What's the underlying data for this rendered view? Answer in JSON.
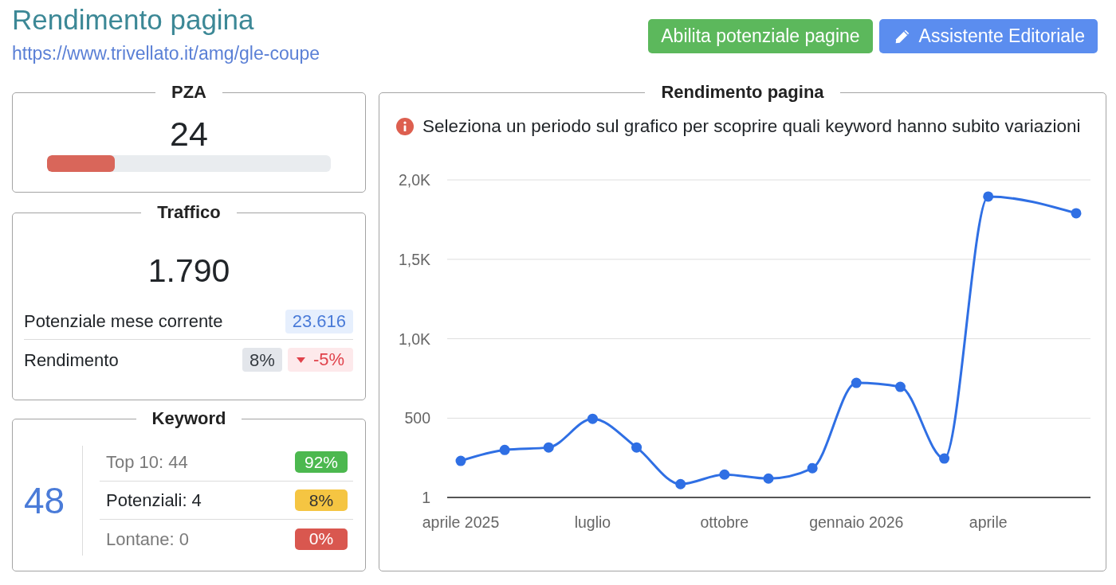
{
  "header": {
    "title": "Rendimento pagina",
    "url": "https://www.trivellato.it/amg/gle-coupe",
    "buttons": [
      {
        "label": "Abilita potenziale pagine",
        "kind": "plain",
        "color": "#5cb85c"
      },
      {
        "label": "Assistente Editoriale",
        "kind": "icon",
        "color": "#5b8def"
      }
    ]
  },
  "pza": {
    "title": "PZA",
    "value": "24",
    "level": 0.24
  },
  "traffic": {
    "title": "Traffico",
    "value": "1.790",
    "rows": [
      {
        "label": "Potenziale mese corrente",
        "badges": [
          {
            "text": "23.616",
            "kind": "info"
          }
        ]
      },
      {
        "label": "Rendimento",
        "badges": [
          {
            "text": "8%",
            "kind": "neutral"
          },
          {
            "text": "-5%",
            "kind": "down"
          }
        ]
      }
    ]
  },
  "keywords": {
    "title": "Keyword",
    "total": "48",
    "rows": [
      {
        "label": "Top 10: 44",
        "share": "92%",
        "color": "#4cb84f",
        "emphasized": false
      },
      {
        "label": "Potenziali: 4",
        "share": "8%",
        "color": "#f5c542",
        "emphasized": true
      },
      {
        "label": "Lontane: 0",
        "share": "0%",
        "color": "#d9574f",
        "emphasized": false
      }
    ]
  },
  "chart": {
    "title": "Rendimento pagina",
    "hint": "Seleziona un periodo sul grafico per scoprire quali keyword hanno subito variazioni",
    "chart_data": {
      "type": "line",
      "categories": [
        "aprile 2025",
        null,
        null,
        "luglio",
        null,
        null,
        "ottobre",
        null,
        null,
        "gennaio 2026",
        null,
        null,
        "aprile",
        null,
        null
      ],
      "series": [
        {
          "color": "#2f6fe4",
          "marker": "circle",
          "values": [
            231,
            300,
            316,
            496,
            316,
            85,
            145,
            120,
            185,
            722,
            697,
            246,
            1895,
            null,
            1790
          ]
        }
      ],
      "grid": true,
      "ylim": [
        1,
        2000
      ],
      "yticks": [
        {
          "value": 1,
          "label": "1"
        },
        {
          "value": 500,
          "label": "500"
        },
        {
          "value": 1000,
          "label": "1,0K"
        },
        {
          "value": 1500,
          "label": "1,5K"
        },
        {
          "value": 2000,
          "label": "2,0K"
        }
      ]
    }
  }
}
